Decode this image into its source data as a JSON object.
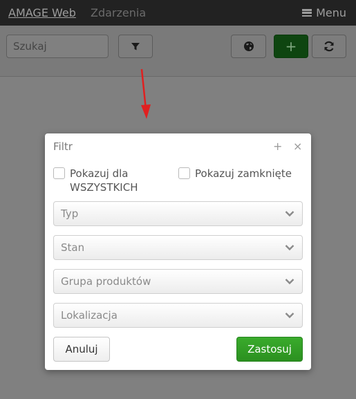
{
  "navbar": {
    "brand": "AMAGE Web",
    "link": "Zdarzenia",
    "menu_label": "Menu",
    "menu_icon": "hamburger-icon"
  },
  "toolbar": {
    "search_placeholder": "Szukaj",
    "filter_icon": "filter-icon",
    "globe_icon": "globe-icon",
    "add_label": "+",
    "refresh_icon": "refresh-icon"
  },
  "annotation": {
    "arrow_color": "#e02020"
  },
  "modal": {
    "title": "Filtr",
    "expand_label": "+",
    "close_label": "×",
    "checkboxes": [
      {
        "label": "Pokazuj dla WSZYSTKICH",
        "checked": false
      },
      {
        "label": "Pokazuj zamknięte",
        "checked": false
      }
    ],
    "selects": [
      {
        "placeholder": "Typ"
      },
      {
        "placeholder": "Stan"
      },
      {
        "placeholder": "Grupa produktów"
      },
      {
        "placeholder": "Lokalizacja"
      }
    ],
    "cancel_label": "Anuluj",
    "apply_label": "Zastosuj"
  },
  "colors": {
    "navbar_bg": "#222222",
    "overlay": "#808080",
    "primary_green": "#2e9a22"
  }
}
